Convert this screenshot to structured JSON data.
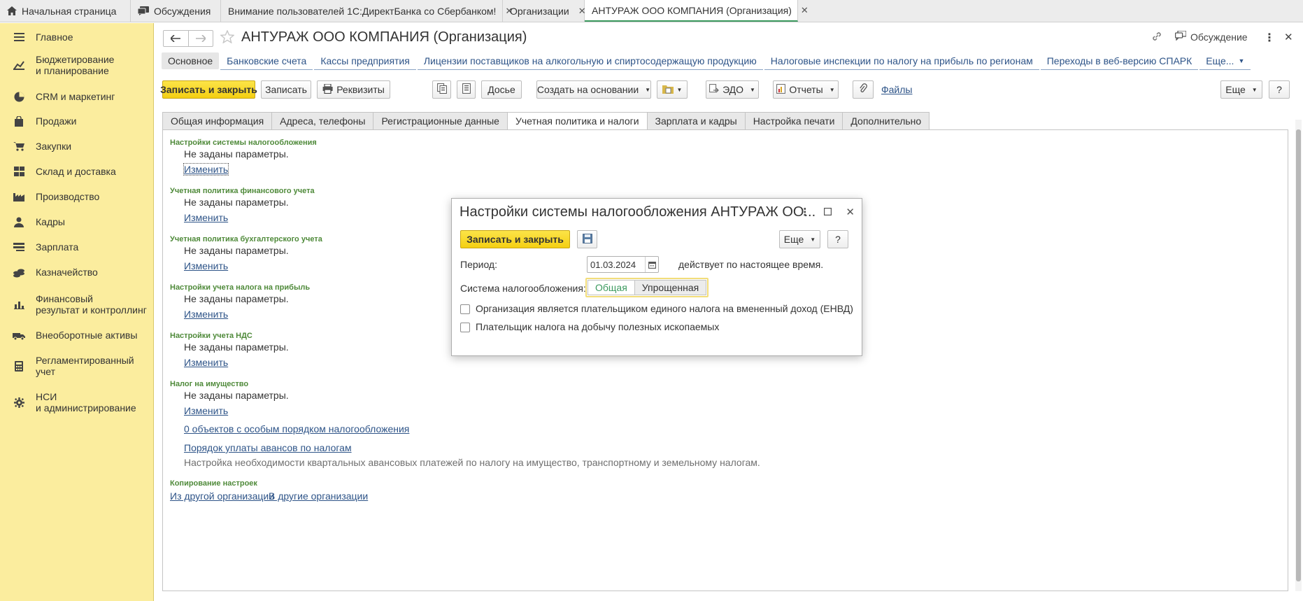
{
  "top_tabs": [
    {
      "label": "Начальная страница",
      "icon": "home-icon"
    },
    {
      "label": "Обсуждения",
      "icon": "chat-icon"
    },
    {
      "label": "Внимание пользователей 1С:ДиректБанка со Сбербанком!",
      "closable": true
    },
    {
      "label": "Организации",
      "closable": true
    },
    {
      "label": "АНТУРАЖ ООО КОМПАНИЯ (Организация)",
      "closable": true,
      "active": true
    }
  ],
  "sidebar": {
    "items": [
      {
        "label": "Главное",
        "icon": "menu-lines-icon"
      },
      {
        "label": "Бюджетирование\nи планирование",
        "icon": "budget-icon"
      },
      {
        "label": "CRM и маркетинг",
        "icon": "pie-chart-icon"
      },
      {
        "label": "Продажи",
        "icon": "shopping-bag-icon"
      },
      {
        "label": "Закупки",
        "icon": "cart-icon"
      },
      {
        "label": "Склад и доставка",
        "icon": "warehouse-icon"
      },
      {
        "label": "Производство",
        "icon": "factory-icon"
      },
      {
        "label": "Кадры",
        "icon": "person-icon"
      },
      {
        "label": "Зарплата",
        "icon": "salary-icon"
      },
      {
        "label": "Казначейство",
        "icon": "coins-icon"
      },
      {
        "label": "Финансовый\nрезультат и контроллинг",
        "icon": "bar-chart-icon"
      },
      {
        "label": "Внеоборотные активы",
        "icon": "assets-icon"
      },
      {
        "label": "Регламентированный\nучет",
        "icon": "calculator-icon"
      },
      {
        "label": "НСИ\nи администрирование",
        "icon": "gear-icon"
      }
    ]
  },
  "form": {
    "title": "АНТУРАЖ ООО КОМПАНИЯ (Организация)",
    "discussion_label": "Обсуждение",
    "sections": [
      "Основное",
      "Банковские счета",
      "Кассы предприятия",
      "Лицензии поставщиков на алкогольную и спиртосодержащую продукцию",
      "Налоговые инспекции по налогу на прибыль по регионам",
      "Переходы в веб-версию СПАРК"
    ],
    "sections_more": "Еще...",
    "toolbar": {
      "save_close": "Записать и закрыть",
      "save": "Записать",
      "requisites": "Реквизиты",
      "dossier": "Досье",
      "create_based": "Создать на основании",
      "edo": "ЭДО",
      "reports": "Отчеты",
      "files": "Файлы",
      "more": "Еще",
      "help": "?"
    },
    "tabs": [
      "Общая информация",
      "Адреса, телефоны",
      "Регистрационные данные",
      "Учетная политика и налоги",
      "Зарплата и кадры",
      "Настройка печати",
      "Дополнительно"
    ],
    "active_tab": 3,
    "groups": [
      {
        "title": "Настройки системы налогообложения",
        "text": "Не заданы параметры.",
        "link": "Изменить"
      },
      {
        "title": "Учетная политика финансового учета",
        "text": "Не заданы параметры.",
        "link": "Изменить"
      },
      {
        "title": "Учетная политика бухгалтерского учета",
        "text": "Не заданы параметры.",
        "link": "Изменить"
      },
      {
        "title": "Настройки учета налога на прибыль",
        "text": "Не заданы параметры.",
        "link": "Изменить"
      },
      {
        "title": "Настройки учета НДС",
        "text": "Не заданы параметры.",
        "link": "Изменить"
      },
      {
        "title": "Налог на имущество",
        "text": "Не заданы параметры.",
        "link": "Изменить"
      }
    ],
    "special_objects_link": "0 объектов с особым порядком налогообложения",
    "advance_link": "Порядок уплаты авансов по налогам",
    "advance_note": "Настройка необходимости квартальных авансовых платежей по налогу на имущество, транспортному и земельному налогам.",
    "copy_group_title": "Копирование настроек",
    "copy_from_link": "Из другой организации",
    "copy_to_link": "В другие организации"
  },
  "dialog": {
    "title": "Настройки системы налогообложения АНТУРАЖ ОО...",
    "save_close": "Записать и закрыть",
    "more": "Еще",
    "help": "?",
    "period_label": "Период:",
    "period_value": "01.03.2024",
    "period_suffix": "действует по настоящее время.",
    "tax_system_label": "Система налогообложения:",
    "tax_options": [
      "Общая",
      "Упрощенная"
    ],
    "tax_selected": "Общая",
    "checkbox_envd": "Организация является плательщиком единого налога на вмененный доход (ЕНВД)",
    "checkbox_envd_checked": false,
    "checkbox_mining": "Плательщик налога на добычу полезных ископаемых",
    "checkbox_mining_checked": false
  }
}
